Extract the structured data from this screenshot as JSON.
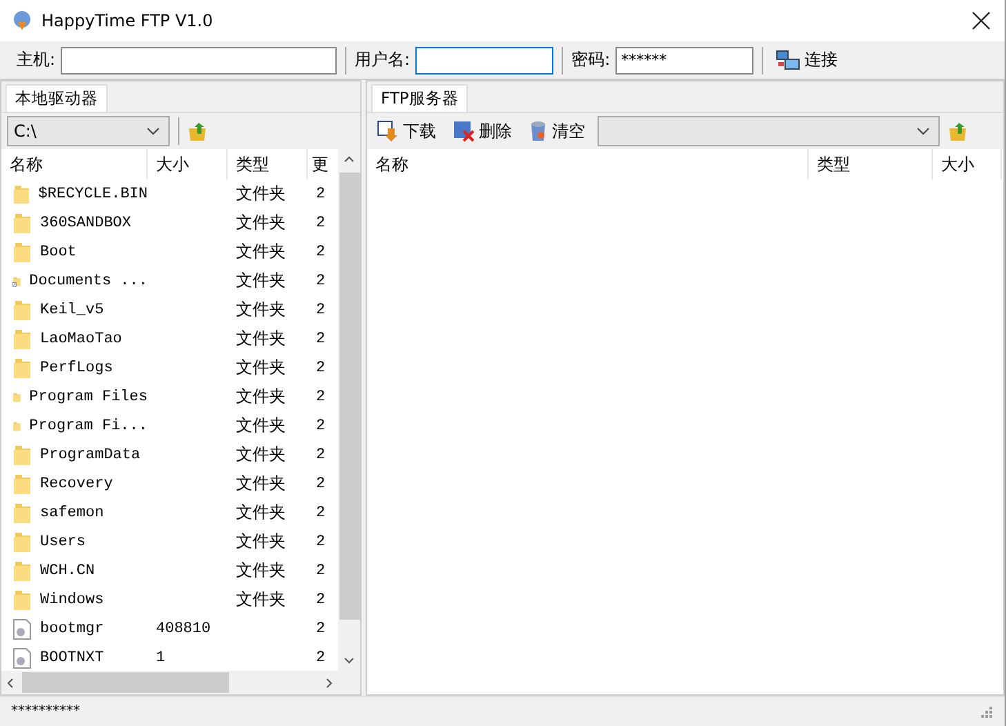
{
  "window": {
    "title": "HappyTime FTP V1.0"
  },
  "connection": {
    "host_label": "主机:",
    "user_label": "用户名:",
    "user_focused": true,
    "password_label": "密码:",
    "password": "******",
    "connect": "连接"
  },
  "local": {
    "tab": "本地驱动器",
    "drive": "C:\\",
    "columns": [
      "名称",
      "大小",
      "类型",
      "更"
    ],
    "files": [
      {
        "kind": "folder",
        "name": "$RECYCLE.BIN",
        "type": "文件夹",
        "date": "2"
      },
      {
        "kind": "folder",
        "name": "360SANDBOX",
        "type": "文件夹",
        "date": "2"
      },
      {
        "kind": "folder",
        "name": "Boot",
        "type": "文件夹",
        "date": "2"
      },
      {
        "kind": "shortcut",
        "name": "Documents ...",
        "type": "文件夹",
        "date": "2"
      },
      {
        "kind": "folder",
        "name": "Keil_v5",
        "type": "文件夹",
        "date": "2"
      },
      {
        "kind": "folder",
        "name": "LaoMaoTao",
        "type": "文件夹",
        "date": "2"
      },
      {
        "kind": "folder",
        "name": "PerfLogs",
        "type": "文件夹",
        "date": "2"
      },
      {
        "kind": "folder",
        "name": "Program Files",
        "type": "文件夹",
        "date": "2"
      },
      {
        "kind": "folder",
        "name": "Program Fi...",
        "type": "文件夹",
        "date": "2"
      },
      {
        "kind": "folder",
        "name": "ProgramData",
        "type": "文件夹",
        "date": "2"
      },
      {
        "kind": "folder",
        "name": "Recovery",
        "type": "文件夹",
        "date": "2"
      },
      {
        "kind": "folder",
        "name": "safemon",
        "type": "文件夹",
        "date": "2"
      },
      {
        "kind": "folder",
        "name": "Users",
        "type": "文件夹",
        "date": "2"
      },
      {
        "kind": "folder",
        "name": "WCH.CN",
        "type": "文件夹",
        "date": "2"
      },
      {
        "kind": "folder",
        "name": "Windows",
        "type": "文件夹",
        "date": "2"
      },
      {
        "kind": "file",
        "name": "bootmgr",
        "size": "408810",
        "date": "2"
      },
      {
        "kind": "file",
        "name": "BOOTNXT",
        "size": "1",
        "date": "2"
      }
    ]
  },
  "remote": {
    "tab": "FTP服务器",
    "download": "下载",
    "delete": "删除",
    "clear": "清空",
    "columns": [
      "名称",
      "类型",
      "大小"
    ]
  },
  "status_bar": {
    "text": "**********"
  }
}
